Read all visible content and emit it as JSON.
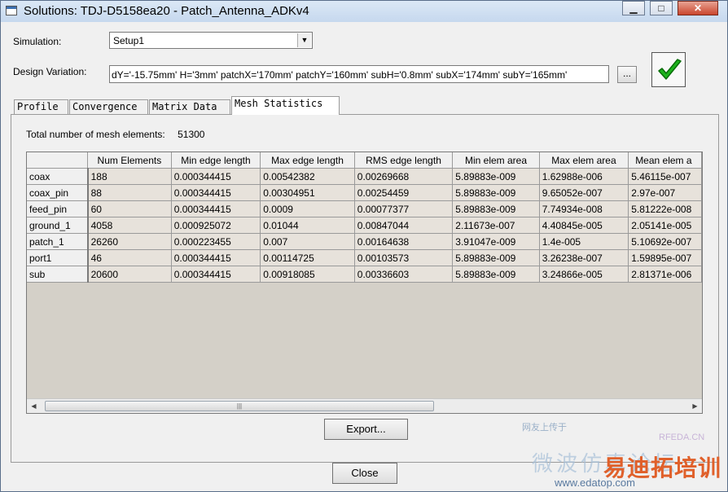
{
  "window": {
    "title": "Solutions: TDJ-D5158ea20 - Patch_Antenna_ADKv4",
    "minimize": "▁",
    "maximize": "□",
    "close": "✕"
  },
  "simulation": {
    "label": "Simulation:",
    "value": "Setup1"
  },
  "design_variation": {
    "label": "Design Variation:",
    "value": "dY='-15.75mm' H='3mm' patchX='170mm' patchY='160mm' subH='0.8mm' subX='174mm' subY='165mm'",
    "browse_label": "..."
  },
  "status": {
    "icon": "check-icon",
    "color": "#1db31d"
  },
  "tabs": [
    {
      "label": "Profile"
    },
    {
      "label": "Convergence"
    },
    {
      "label": "Matrix Data"
    },
    {
      "label": "Mesh Statistics"
    }
  ],
  "mesh": {
    "total_label": "Total number of mesh elements:",
    "total_value": "51300",
    "columns": [
      "Num Elements",
      "Min edge length",
      "Max edge length",
      "RMS edge length",
      "Min elem area",
      "Max elem area",
      "Mean elem a"
    ],
    "rows": [
      {
        "name": "coax",
        "cells": [
          "188",
          "0.000344415",
          "0.00542382",
          "0.00269668",
          "5.89883e-009",
          "1.62988e-006",
          "5.46115e-007"
        ]
      },
      {
        "name": "coax_pin",
        "cells": [
          "88",
          "0.000344415",
          "0.00304951",
          "0.00254459",
          "5.89883e-009",
          "9.65052e-007",
          "2.97e-007"
        ]
      },
      {
        "name": "feed_pin",
        "cells": [
          "60",
          "0.000344415",
          "0.0009",
          "0.00077377",
          "5.89883e-009",
          "7.74934e-008",
          "5.81222e-008"
        ]
      },
      {
        "name": "ground_1",
        "cells": [
          "4058",
          "0.000925072",
          "0.01044",
          "0.00847044",
          "2.11673e-007",
          "4.40845e-005",
          "2.05141e-005"
        ]
      },
      {
        "name": "patch_1",
        "cells": [
          "26260",
          "0.000223455",
          "0.007",
          "0.00164638",
          "3.91047e-009",
          "1.4e-005",
          "5.10692e-007"
        ]
      },
      {
        "name": "port1",
        "cells": [
          "46",
          "0.000344415",
          "0.00114725",
          "0.00103573",
          "5.89883e-009",
          "3.26238e-007",
          "1.59895e-007"
        ]
      },
      {
        "name": "sub",
        "cells": [
          "20600",
          "0.000344415",
          "0.00918085",
          "0.00336603",
          "5.89883e-009",
          "3.24866e-005",
          "2.81371e-006"
        ]
      }
    ]
  },
  "buttons": {
    "export": "Export...",
    "close": "Close"
  },
  "watermark": {
    "line1": "网友上传于",
    "line2": "RFEDA.CN",
    "line3": "微波仿真论坛",
    "brand": "易迪拓培训",
    "url": "www.edatop.com"
  }
}
